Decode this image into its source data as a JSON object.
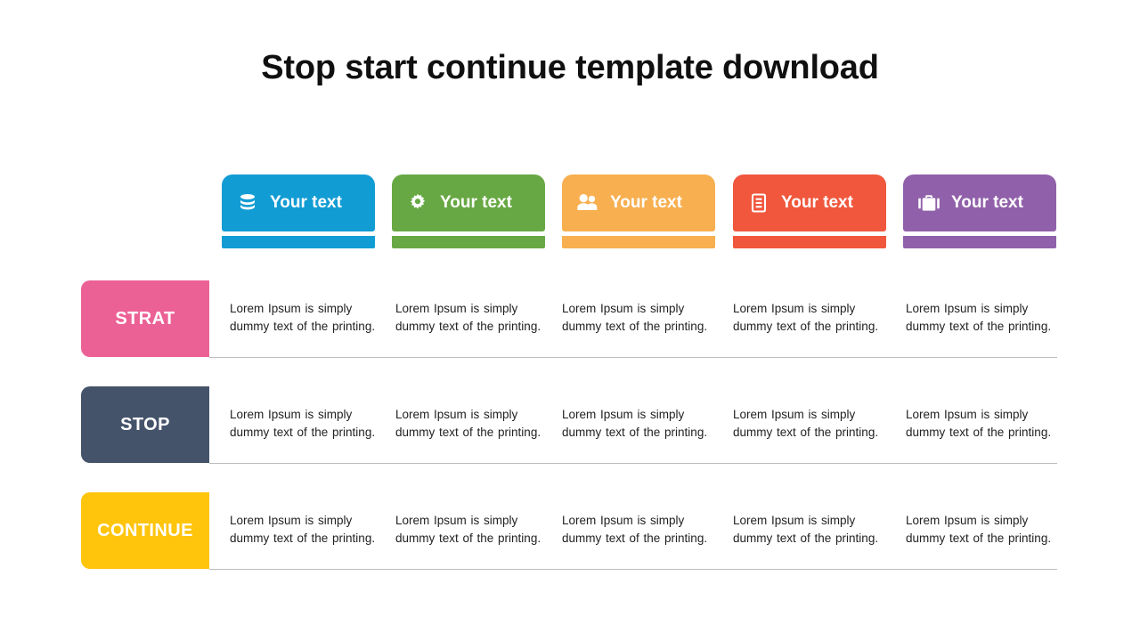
{
  "title": "Stop start continue template download",
  "header_cards": [
    {
      "label": "Your text",
      "icon": "database-icon",
      "color": "#129CD4"
    },
    {
      "label": "Your text",
      "icon": "gear-icon",
      "color": "#68A844"
    },
    {
      "label": "Your text",
      "icon": "users-icon",
      "color": "#F7AF50"
    },
    {
      "label": "Your text",
      "icon": "document-icon",
      "color": "#F0573C"
    },
    {
      "label": "Your text",
      "icon": "briefcase-icon",
      "color": "#9061AA"
    }
  ],
  "rows": [
    {
      "label": "STRAT",
      "color": "#EC6195",
      "cells": [
        "Lorem Ipsum is simply dummy text of the printing.",
        "Lorem Ipsum is simply dummy text of the printing.",
        "Lorem Ipsum is simply dummy text of the printing.",
        "Lorem Ipsum is simply dummy text of the printing.",
        "Lorem Ipsum is simply dummy text of the printing."
      ]
    },
    {
      "label": "STOP",
      "color": "#44536A",
      "cells": [
        "Lorem Ipsum is simply dummy text of the printing.",
        "Lorem Ipsum is simply dummy text of the printing.",
        "Lorem Ipsum is simply dummy text of the printing.",
        "Lorem Ipsum is simply dummy text of the printing.",
        "Lorem Ipsum is simply dummy text of the printing."
      ]
    },
    {
      "label": "CONTINUE",
      "color": "#FFC40C",
      "cells": [
        "Lorem Ipsum is simply dummy text of the printing.",
        "Lorem Ipsum is simply dummy text of the printing.",
        "Lorem Ipsum is simply dummy text of the printing.",
        "Lorem Ipsum is simply dummy text of the printing.",
        "Lorem Ipsum is simply dummy text of the printing."
      ]
    }
  ],
  "separator_color": "#bdbdbd",
  "background_color": "#ffffff",
  "title_color": "#101010"
}
